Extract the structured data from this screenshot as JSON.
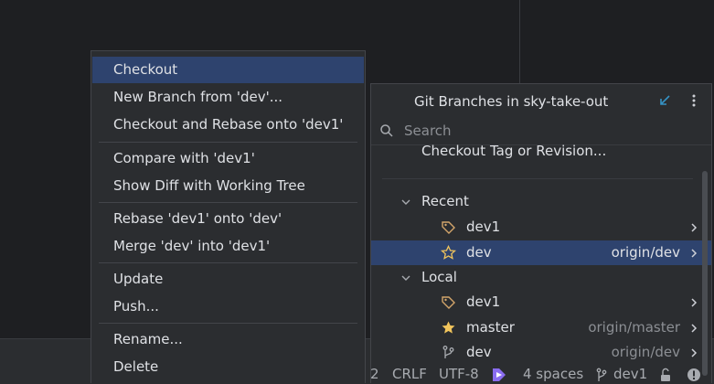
{
  "context_menu": {
    "items": [
      {
        "label": "Checkout"
      },
      {
        "label": "New Branch from 'dev'..."
      },
      {
        "label": "Checkout and Rebase onto 'dev1'"
      },
      {
        "label": "Compare with 'dev1'"
      },
      {
        "label": "Show Diff with Working Tree"
      },
      {
        "label": "Rebase 'dev1' onto 'dev'"
      },
      {
        "label": "Merge 'dev' into 'dev1'"
      },
      {
        "label": "Update"
      },
      {
        "label": "Push..."
      },
      {
        "label": "Rename..."
      },
      {
        "label": "Delete"
      }
    ]
  },
  "branches_popup": {
    "title": "Git Branches in sky-take-out",
    "search_placeholder": "Search",
    "checkout_tag_label": "Checkout Tag or Revision...",
    "recent": {
      "label": "Recent",
      "items": [
        {
          "name": "dev1",
          "remote": "",
          "icon": "tag-icon"
        },
        {
          "name": "dev",
          "remote": "origin/dev",
          "icon": "star-outline-icon"
        }
      ]
    },
    "local": {
      "label": "Local",
      "items": [
        {
          "name": "dev1",
          "remote": "",
          "icon": "tag-icon"
        },
        {
          "name": "master",
          "remote": "origin/master",
          "icon": "star-filled-icon"
        },
        {
          "name": "dev",
          "remote": "origin/dev",
          "icon": "branch-icon"
        }
      ]
    }
  },
  "status_bar": {
    "line_col": "2",
    "line_separator": "CRLF",
    "encoding": "UTF-8",
    "indent": "4 spaces",
    "branch": "dev1"
  },
  "colors": {
    "selection": "#2e436e",
    "accent_blue": "#3592c4",
    "star_yellow": "#f2c55c",
    "tag_orange": "#d3a56a"
  }
}
